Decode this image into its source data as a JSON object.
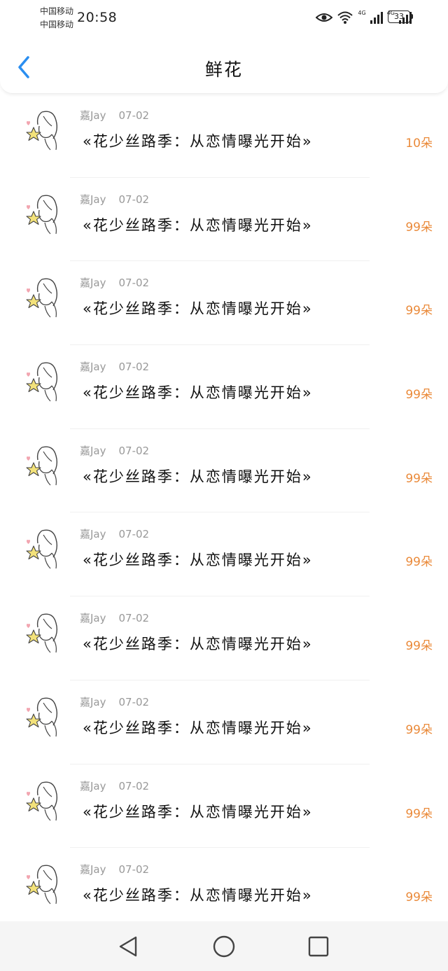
{
  "status_bar": {
    "carrier_1": "中国移动",
    "carrier_2": "中国移动",
    "time": "20:58",
    "network_1": "4G",
    "network_2": "4G",
    "battery": "33",
    "icons": [
      "eye-icon",
      "wifi-icon",
      "signal-icon",
      "signal-icon",
      "battery-icon"
    ]
  },
  "header": {
    "title": "鲜花",
    "back_icon": "chevron-left-icon",
    "accent_color": "#2a8ef0"
  },
  "list": {
    "count_color": "#ea8a3a",
    "items": [
      {
        "user": "嘉Jay",
        "date": "07-02",
        "title": "«花少丝路季：从恋情曝光开始»",
        "count": "10朵"
      },
      {
        "user": "嘉Jay",
        "date": "07-02",
        "title": "«花少丝路季：从恋情曝光开始»",
        "count": "99朵"
      },
      {
        "user": "嘉Jay",
        "date": "07-02",
        "title": "«花少丝路季：从恋情曝光开始»",
        "count": "99朵"
      },
      {
        "user": "嘉Jay",
        "date": "07-02",
        "title": "«花少丝路季：从恋情曝光开始»",
        "count": "99朵"
      },
      {
        "user": "嘉Jay",
        "date": "07-02",
        "title": "«花少丝路季：从恋情曝光开始»",
        "count": "99朵"
      },
      {
        "user": "嘉Jay",
        "date": "07-02",
        "title": "«花少丝路季：从恋情曝光开始»",
        "count": "99朵"
      },
      {
        "user": "嘉Jay",
        "date": "07-02",
        "title": "«花少丝路季：从恋情曝光开始»",
        "count": "99朵"
      },
      {
        "user": "嘉Jay",
        "date": "07-02",
        "title": "«花少丝路季：从恋情曝光开始»",
        "count": "99朵"
      },
      {
        "user": "嘉Jay",
        "date": "07-02",
        "title": "«花少丝路季：从恋情曝光开始»",
        "count": "99朵"
      },
      {
        "user": "嘉Jay",
        "date": "07-02",
        "title": "«花少丝路季：从恋情曝光开始»",
        "count": "99朵"
      }
    ]
  },
  "nav_bar": {
    "icons": [
      "triangle-back-icon",
      "circle-home-icon",
      "square-recents-icon"
    ]
  }
}
